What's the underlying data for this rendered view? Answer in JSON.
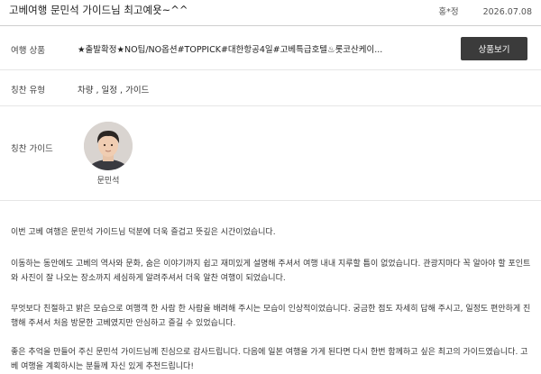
{
  "header": {
    "title": "고베여행 문민석 가이드님 최고예욧~^^",
    "author": "홍*정",
    "date": "2026.07.08"
  },
  "product": {
    "label": "여행 상품",
    "value": "★출발확정★NO팁/NO옵션#TOPPICK#대한항공4일#고베특급호텔♨롯코산케이...",
    "button_label": "상품보기"
  },
  "praise_type": {
    "label": "칭찬 유형",
    "value": "차량 , 일정 , 가이드"
  },
  "praise_guide": {
    "label": "칭찬 가이드",
    "name": "문민석",
    "avatar_icon": "person-photo-icon"
  },
  "review": {
    "paragraphs": [
      "이번 고베 여행은 문민석 가이드님 덕분에 더욱 즐겁고 뜻깊은 시간이었습니다.",
      "이동하는 동안에도 고베의 역사와 문화, 숨은 이야기까지 쉽고 재미있게 설명해 주셔서 여행 내내 지루할 틈이 없었습니다. 관광지마다 꼭 알아야 할 포인트와 사진이 잘 나오는 장소까지 세심하게 알려주셔서 더욱 알찬 여행이 되었습니다.",
      "무엇보다 친절하고 밝은 모습으로 여행객 한 사람 한 사람을 배려해 주시는 모습이 인상적이었습니다. 궁금한 점도 자세히 답해 주시고, 일정도 편안하게 진행해 주셔서 처음 방문한 고베였지만 안심하고 즐길 수 있었습니다.",
      "좋은 추억을 만들어 주신 문민석 가이드님께 진심으로 감사드립니다. 다음에 일본 여행을 가게 된다면 다시 한번 함께하고 싶은 최고의 가이드였습니다. 고베 여행을 계획하시는 분들께 자신 있게 추천드립니다!"
    ]
  }
}
